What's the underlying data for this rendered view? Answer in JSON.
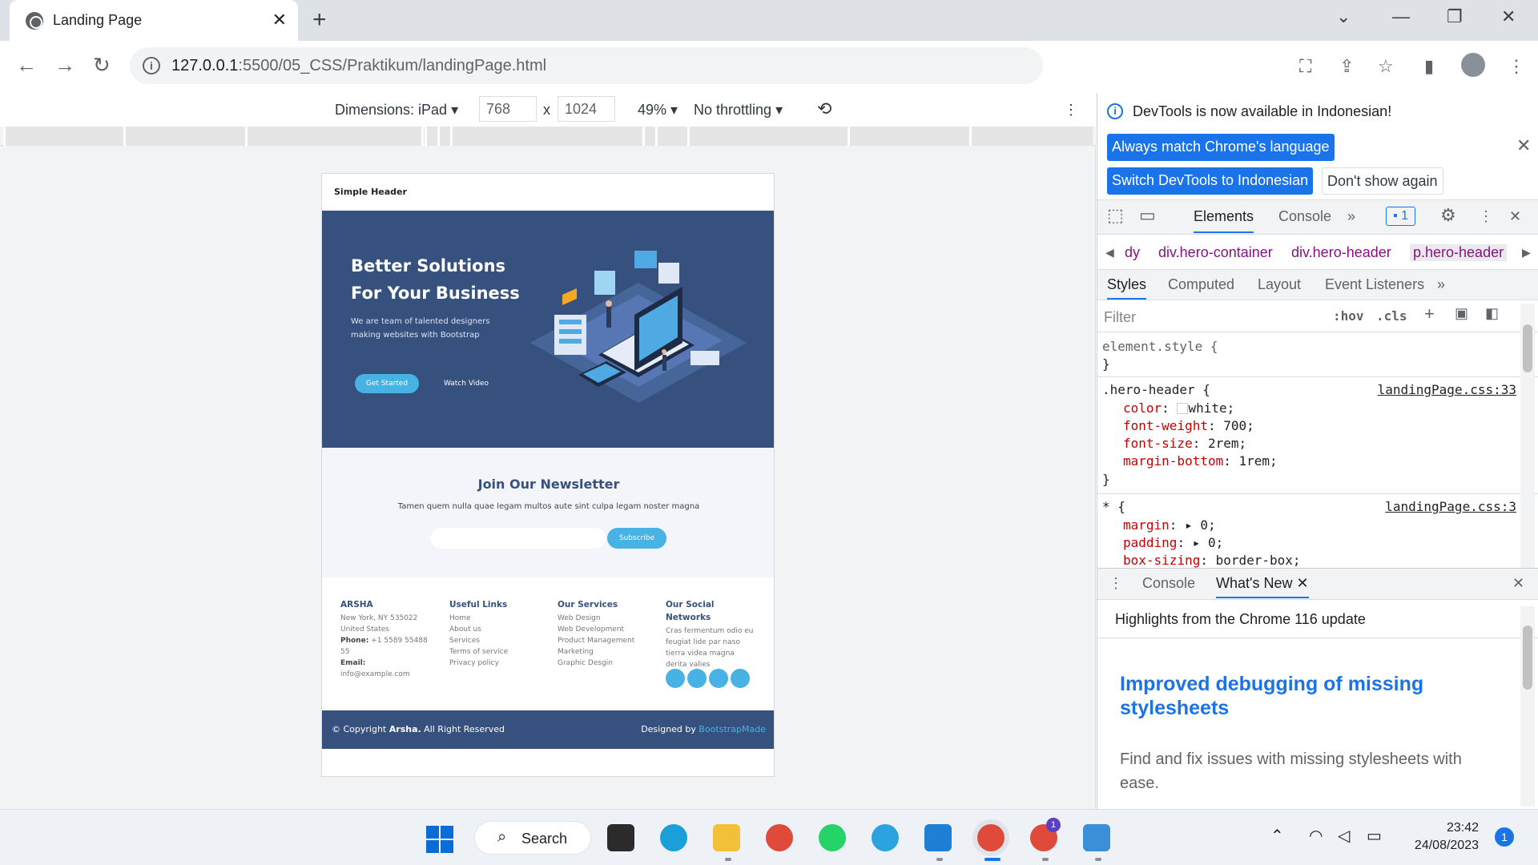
{
  "browser": {
    "tab_title": "Landing Page",
    "url_host": "127.0.0.1",
    "url_path": ":5500/05_CSS/Praktikum/landingPage.html"
  },
  "device_toolbar": {
    "dimensions_label": "Dimensions: iPad",
    "width": "768",
    "times": "x",
    "height": "1024",
    "zoom": "49%",
    "throttling": "No throttling"
  },
  "page": {
    "header_title": "Simple Header",
    "hero": {
      "title_line1": "Better Solutions",
      "title_line2": "For Your Business",
      "subtitle": "We are team of talented designers making websites with Bootstrap",
      "primary_button": "Get Started",
      "secondary_button": "Watch Video"
    },
    "newsletter": {
      "title": "Join Our Newsletter",
      "text": "Tamen quem nulla quae legam multos aute sint culpa legam noster magna",
      "button": "Subscribe"
    },
    "footer": {
      "brand": "ARSHA",
      "address1": "New York, NY 535022",
      "address2": "United States",
      "phone_label": "Phone:",
      "phone": "+1 5589 55488 55",
      "email_label": "Email:",
      "email": "info@example.com",
      "links_title": "Useful Links",
      "links": [
        "Home",
        "About us",
        "Services",
        "Terms of service",
        "Privacy policy"
      ],
      "services_title": "Our Services",
      "services": [
        "Web Design",
        "Web Development",
        "Product Management",
        "Marketing",
        "Graphic Desgin"
      ],
      "social_title": "Our Social Networks",
      "social_text": "Cras fermentum odio eu feugiat lide par naso tierra videa magna derita valies"
    },
    "copyright": {
      "prefix": "© Copyright",
      "brand": "Arsha.",
      "suffix": "All Right Reserved",
      "designed_by": "Designed by",
      "designer": "BootstrapMade"
    }
  },
  "devtools": {
    "notice": "DevTools is now available in Indonesian!",
    "btn_match": "Always match Chrome's language",
    "btn_switch": "Switch DevTools to Indonesian",
    "btn_dont_show": "Don't show again",
    "tabs": [
      "Elements",
      "Console"
    ],
    "issues_count": "1",
    "breadcrumbs": [
      "dy",
      "div.hero-container",
      "div.hero-header",
      "p.hero-header"
    ],
    "style_tabs": [
      "Styles",
      "Computed",
      "Layout",
      "Event Listeners"
    ],
    "filter_placeholder": "Filter",
    "hov": ":hov",
    "cls": ".cls",
    "rule_element": "element.style {",
    "close_brace": "}",
    "rule1_selector": ".hero-header {",
    "rule1_source": "landingPage.css:33",
    "rule1_props": [
      {
        "name": "color",
        "value": "white;"
      },
      {
        "name": "font-weight",
        "value": "700;"
      },
      {
        "name": "font-size",
        "value": "2rem;"
      },
      {
        "name": "margin-bottom",
        "value": "1rem;"
      }
    ],
    "rule2_selector": "* {",
    "rule2_source": "landingPage.css:3",
    "rule2_props": [
      {
        "name": "margin",
        "value": "0;"
      },
      {
        "name": "padding",
        "value": "0;"
      },
      {
        "name": "box-sizing",
        "value": "border-box;"
      }
    ],
    "drawer_tabs": [
      "Console",
      "What's New"
    ],
    "drawer_heading": "Highlights from the Chrome 116 update",
    "whatsnew_title": "Improved debugging of missing stylesheets",
    "whatsnew_text": "Find and fix issues with missing stylesheets with ease."
  },
  "taskbar": {
    "search_label": "Search",
    "time": "23:42",
    "date": "24/08/2023",
    "notifications": "1",
    "chrome_badge": "1"
  },
  "colors": {
    "hero_bg": "#37517e",
    "accent": "#47b2e4",
    "devtools_blue": "#1a73e8"
  }
}
